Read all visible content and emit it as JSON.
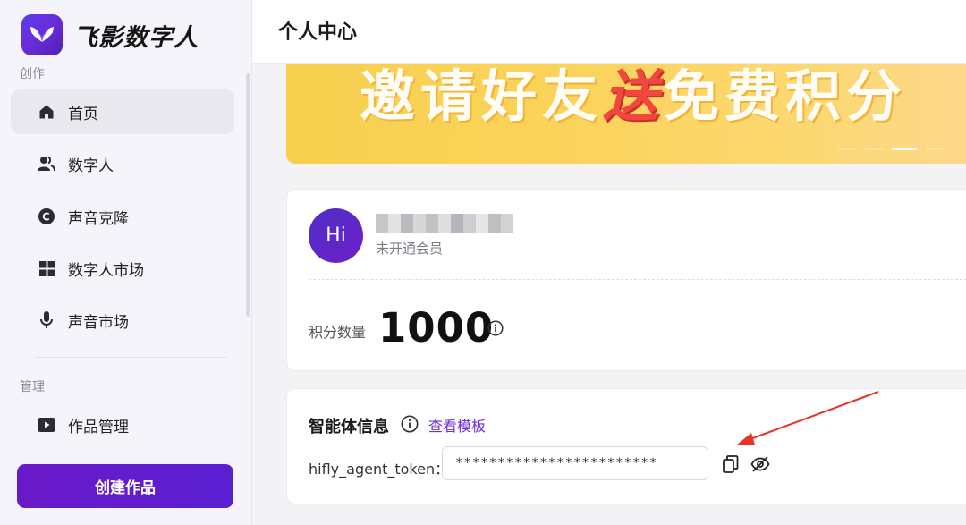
{
  "brand": {
    "name": "飞影数字人"
  },
  "sidebar": {
    "section_create": "创作",
    "section_manage": "管理",
    "items": [
      {
        "label": "首页",
        "icon": "home-icon"
      },
      {
        "label": "数字人",
        "icon": "user-group-icon"
      },
      {
        "label": "声音克隆",
        "icon": "copyright-c-icon"
      },
      {
        "label": "数字人市场",
        "icon": "grid-icon"
      },
      {
        "label": "声音市场",
        "icon": "microphone-icon"
      },
      {
        "label": "作品管理",
        "icon": "video-play-icon"
      }
    ],
    "create_button": "创建作品"
  },
  "header": {
    "title": "个人中心"
  },
  "banner": {
    "text_before": "邀请好友",
    "text_accent": "送",
    "text_after": "免费积分",
    "slide_count": 4,
    "active_slide": 3
  },
  "user": {
    "avatar_text": "Hi",
    "membership_status": "未开通会员",
    "points_label": "积分数量",
    "points_value": "1000"
  },
  "agent": {
    "title": "智能体信息",
    "template_link": "查看模板",
    "token_label": "hifly_agent_token：",
    "token_value": "************************"
  },
  "colors": {
    "accent": "#6b2fd6",
    "create_button": "#6a19c8",
    "banner": "#f7cf4e",
    "annotation_arrow": "#e8332a"
  }
}
